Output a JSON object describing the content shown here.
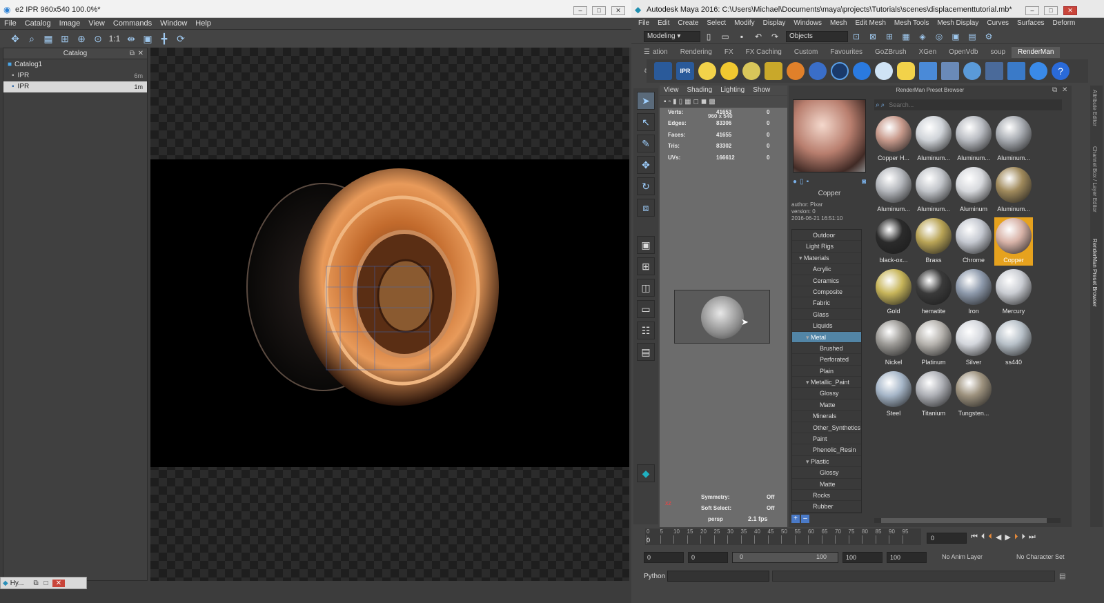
{
  "it": {
    "title": "e2 IPR 960x540 100.0%*",
    "menu": [
      "File",
      "Catalog",
      "Image",
      "View",
      "Commands",
      "Window",
      "Help"
    ],
    "zoom_label": "1:1",
    "catalog_title": "Catalog",
    "catalog_root": "Catalog1",
    "items": [
      {
        "label": "IPR",
        "time": "6m"
      },
      {
        "label": "IPR",
        "time": "1m"
      }
    ],
    "taskbar": "Hy..."
  },
  "maya": {
    "title": "Autodesk Maya 2016: C:\\Users\\Michael\\Documents\\maya\\projects\\Tutorials\\scenes\\displacementtutorial.mb*",
    "menu": [
      "File",
      "Edit",
      "Create",
      "Select",
      "Modify",
      "Display",
      "Windows",
      "Mesh",
      "Edit Mesh",
      "Mesh Tools",
      "Mesh Display",
      "Curves",
      "Surfaces",
      "Deform"
    ],
    "mode": "Modeling",
    "objects": "Objects",
    "shelf_tabs": [
      "ation",
      "Rendering",
      "FX",
      "FX Caching",
      "Custom",
      "Favourites",
      "GoZBrush",
      "XGen",
      "OpenVdb",
      "soup",
      "RenderMan"
    ],
    "active_shelf": "RenderMan",
    "ipr_label": "IPR",
    "viewport_menu": [
      "View",
      "Shading",
      "Lighting",
      "Show"
    ],
    "hud": [
      {
        "k": "Verts:",
        "v": "41653",
        "s": "0"
      },
      {
        "k": "Edges:",
        "v": "83306",
        "s": "0"
      },
      {
        "k": "Faces:",
        "v": "41655",
        "s": "0"
      },
      {
        "k": "Tris:",
        "v": "83302",
        "s": "0"
      },
      {
        "k": "UVs:",
        "v": "166612",
        "s": "0"
      }
    ],
    "res_gate": "960 x 540",
    "symmetry": {
      "k": "Symmetry:",
      "v": "Off"
    },
    "soft_select": {
      "k": "Soft Select:",
      "v": "Off"
    },
    "camera": "persp",
    "fps": "2.1 fps",
    "preset_title": "RenderMan Preset Browser",
    "preset_name": "Copper",
    "preset_meta": [
      "author: Pixar",
      "version: 0",
      "2016-06-21 16:51:10"
    ],
    "search_placeholder": "Search...",
    "tree": [
      {
        "label": "Outdoor",
        "indent": 2
      },
      {
        "label": "Light Rigs",
        "indent": 1
      },
      {
        "label": "Materials",
        "indent": 1,
        "open": true
      },
      {
        "label": "Acrylic",
        "indent": 2
      },
      {
        "label": "Ceramics",
        "indent": 2
      },
      {
        "label": "Composite",
        "indent": 2
      },
      {
        "label": "Fabric",
        "indent": 2
      },
      {
        "label": "Glass",
        "indent": 2
      },
      {
        "label": "Liquids",
        "indent": 2
      },
      {
        "label": "Metal",
        "indent": 2,
        "open": true,
        "selected": true
      },
      {
        "label": "Brushed",
        "indent": 3
      },
      {
        "label": "Perforated",
        "indent": 3
      },
      {
        "label": "Plain",
        "indent": 3
      },
      {
        "label": "Metallic_Paint",
        "indent": 2,
        "open": true
      },
      {
        "label": "Glossy",
        "indent": 3
      },
      {
        "label": "Matte",
        "indent": 3
      },
      {
        "label": "Minerals",
        "indent": 2
      },
      {
        "label": "Other_Synthetics",
        "indent": 2
      },
      {
        "label": "Paint",
        "indent": 2
      },
      {
        "label": "Phenolic_Resin",
        "indent": 2
      },
      {
        "label": "Plastic",
        "indent": 2,
        "open": true
      },
      {
        "label": "Glossy",
        "indent": 3
      },
      {
        "label": "Matte",
        "indent": 3
      },
      {
        "label": "Rocks",
        "indent": 2
      },
      {
        "label": "Rubber",
        "indent": 2
      }
    ],
    "materials": [
      {
        "label": "Copper H...",
        "color": "#c89a8c"
      },
      {
        "label": "Aluminum...",
        "color": "#cfd3d8"
      },
      {
        "label": "Aluminum...",
        "color": "#b9bcc2"
      },
      {
        "label": "Aluminum...",
        "color": "#a9adb3"
      },
      {
        "label": "Aluminum...",
        "color": "#b4b7bc"
      },
      {
        "label": "Aluminum...",
        "color": "#c1c4c9"
      },
      {
        "label": "Aluminum",
        "color": "#d6d8dc"
      },
      {
        "label": "Aluminum...",
        "color": "#a08a5c"
      },
      {
        "label": "black-ox...",
        "color": "#2b2b2b"
      },
      {
        "label": "Brass",
        "color": "#b9a456"
      },
      {
        "label": "Chrome",
        "color": "#c4c8d0"
      },
      {
        "label": "Copper",
        "color": "#d7b2a7",
        "selected": true
      },
      {
        "label": "Gold",
        "color": "#c7b55a"
      },
      {
        "label": "hematite",
        "color": "#3a3a3a"
      },
      {
        "label": "Iron",
        "color": "#8e9aac"
      },
      {
        "label": "Mercury",
        "color": "#c9ccd2"
      },
      {
        "label": "Nickel",
        "color": "#9c9a96"
      },
      {
        "label": "Platinum",
        "color": "#b6b3ae"
      },
      {
        "label": "Silver",
        "color": "#d3d6dc"
      },
      {
        "label": "ss440",
        "color": "#b7c0c8"
      },
      {
        "label": "Steel",
        "color": "#a6b6c8"
      },
      {
        "label": "Titanium",
        "color": "#aeb0b6"
      },
      {
        "label": "Tungsten...",
        "color": "#9d927e"
      }
    ],
    "side_tabs": [
      "Attribute Editor",
      "Channel Box / Layer Editor",
      "RenderMan Preset Browser"
    ],
    "timeline_ticks": [
      "0",
      "5",
      "10",
      "15",
      "20",
      "25",
      "30",
      "35",
      "40",
      "45",
      "50",
      "55",
      "60",
      "65",
      "70",
      "75",
      "80",
      "85",
      "90",
      "95"
    ],
    "timeline_ticks2": [
      "1"
    ],
    "current_frame": "0",
    "range": {
      "start": "0",
      "anim_start": "0",
      "slider_start": "0",
      "slider_end": "100",
      "anim_end": "100",
      "end": "100"
    },
    "anim_layer": "No Anim Layer",
    "char_set": "No Character Set",
    "cmd_label": "Python"
  }
}
